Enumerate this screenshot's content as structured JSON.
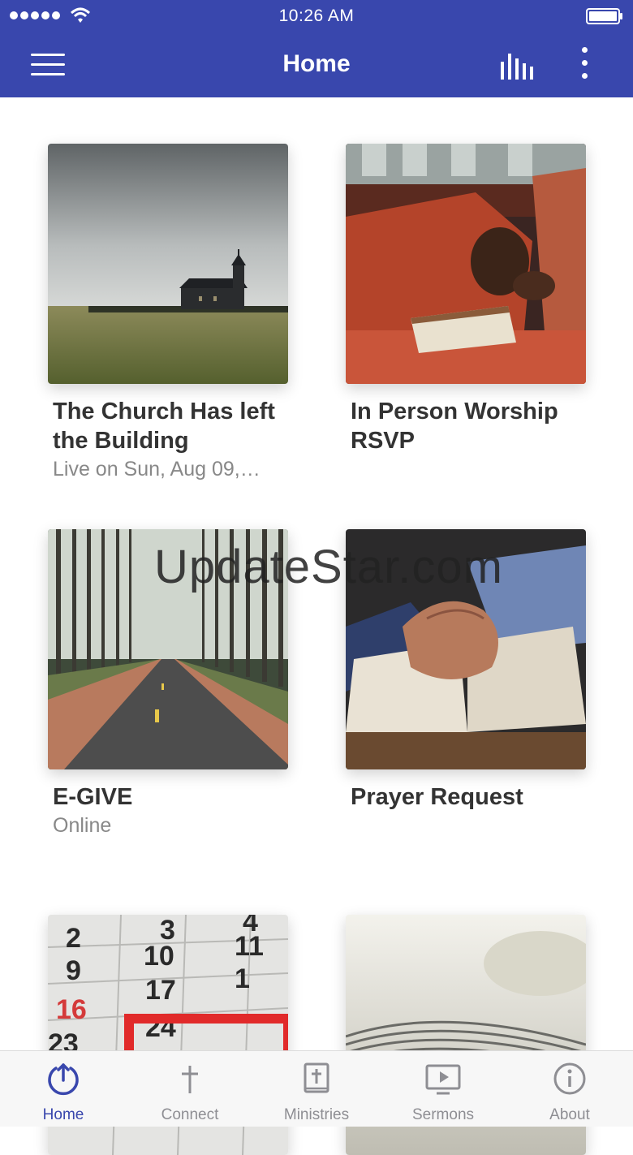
{
  "status_bar": {
    "time": "10:26 AM"
  },
  "app_bar": {
    "title": "Home"
  },
  "watermark": "UpdateStar.com",
  "tiles": [
    {
      "title": "The Church Has left the Building",
      "subtitle": "Live on Sun, Aug 09,…",
      "image": "church-photo"
    },
    {
      "title": "In Person Worship RSVP",
      "subtitle": "",
      "image": "praying-man-photo"
    },
    {
      "title": "E-GIVE",
      "subtitle": "Online",
      "image": "forest-road-photo"
    },
    {
      "title": "Prayer Request",
      "subtitle": "",
      "image": "praying-hands-bible-photo"
    },
    {
      "title": "",
      "subtitle": "",
      "image": "calendar-photo"
    },
    {
      "title": "",
      "subtitle": "",
      "image": "newspaper-photo"
    }
  ],
  "tab_bar": {
    "items": [
      {
        "label": "Home",
        "icon": "home-power-icon",
        "active": true
      },
      {
        "label": "Connect",
        "icon": "cross-icon",
        "active": false
      },
      {
        "label": "Ministries",
        "icon": "bible-icon",
        "active": false
      },
      {
        "label": "Sermons",
        "icon": "tv-play-icon",
        "active": false
      },
      {
        "label": "About",
        "icon": "info-icon",
        "active": false
      }
    ]
  },
  "colors": {
    "primary": "#3947ad",
    "tab_inactive": "#8e8e93",
    "title_text": "#333333",
    "subtitle_text": "#888888"
  }
}
